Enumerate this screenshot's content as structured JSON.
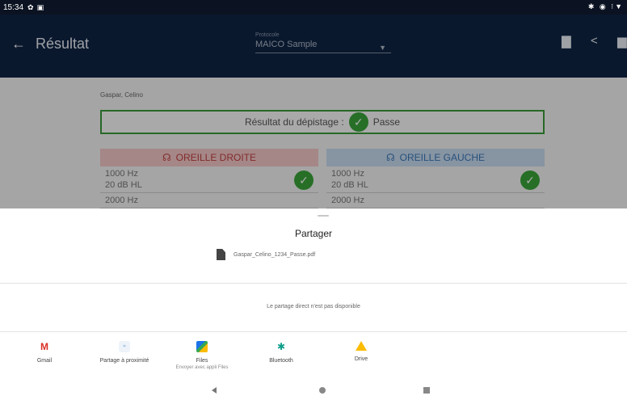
{
  "status_bar": {
    "time": "15:34",
    "icons_left": [
      "settings-icon",
      "screenshot-icon"
    ],
    "icons_right_text": "✱ ◉ ⁝▼"
  },
  "app_bar": {
    "back_icon": "arrow-left-icon",
    "title": "Résultat",
    "protocol_label": "Protocole",
    "protocol_value": "MAICO Sample",
    "actions": [
      "comment-icon",
      "share-icon",
      "print-icon"
    ]
  },
  "content": {
    "patient_name": "Gaspar, Celino",
    "screening_label": "Résultat du dépistage :",
    "screening_result": "Passe",
    "right_ear": {
      "title": "OREILLE DROITE",
      "rows": [
        {
          "freq": "1000 Hz",
          "level": "20 dB HL"
        },
        {
          "freq": "2000 Hz",
          "level": ""
        }
      ]
    },
    "left_ear": {
      "title": "OREILLE GAUCHE",
      "rows": [
        {
          "freq": "1000 Hz",
          "level": "20 dB HL"
        },
        {
          "freq": "2000 Hz",
          "level": ""
        }
      ]
    },
    "colors": {
      "pass": "#3aa43a",
      "right_ear": "#c24040",
      "left_ear": "#3a78b8"
    }
  },
  "share_sheet": {
    "title": "Partager",
    "file_name": "Gaspar_Celino_1234_Passe.pdf",
    "direct_share_message": "Le partage direct n'est pas disponible",
    "apps": [
      {
        "name": "Gmail",
        "icon": "gmail-icon",
        "subtitle": ""
      },
      {
        "name": "Partage à proximité",
        "icon": "nearby-share-icon",
        "subtitle": ""
      },
      {
        "name": "Files",
        "icon": "files-icon",
        "subtitle": "Envoyer avec appli Files"
      },
      {
        "name": "Bluetooth",
        "icon": "bluetooth-icon",
        "subtitle": ""
      },
      {
        "name": "Drive",
        "icon": "drive-icon",
        "subtitle": ""
      }
    ]
  },
  "nav_bar": {
    "buttons": [
      "back-icon",
      "home-icon",
      "recents-icon"
    ]
  }
}
